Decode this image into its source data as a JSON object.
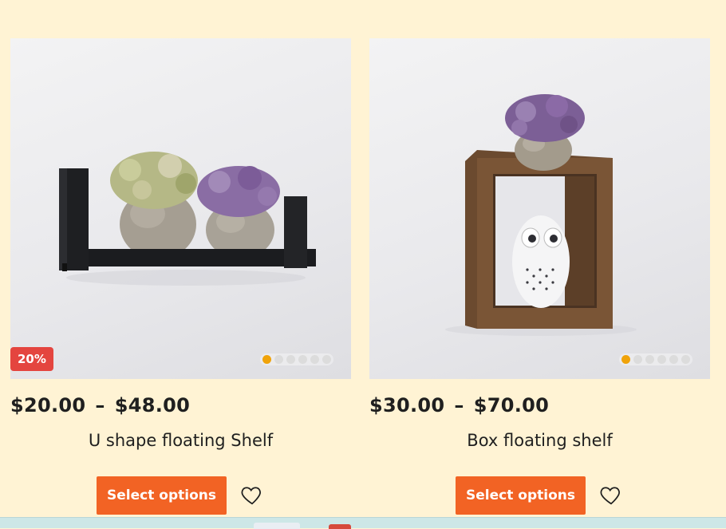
{
  "products": [
    {
      "badge": "20%",
      "price_low": "$20.00",
      "price_sep": "–",
      "price_high": "$48.00",
      "title": "U shape floating Shelf",
      "button_label": "Select options",
      "gallery_count": 6,
      "gallery_active": 1
    },
    {
      "badge": "",
      "price_low": "$30.00",
      "price_sep": "–",
      "price_high": "$70.00",
      "title": "Box floating shelf",
      "button_label": "Select options",
      "gallery_count": 6,
      "gallery_active": 1
    }
  ],
  "colors": {
    "page_bg": "#fff3d4",
    "button": "#f26324",
    "badge": "#e4453f",
    "dot_active": "#f0a30a"
  },
  "icons": [
    "heart-icon"
  ]
}
